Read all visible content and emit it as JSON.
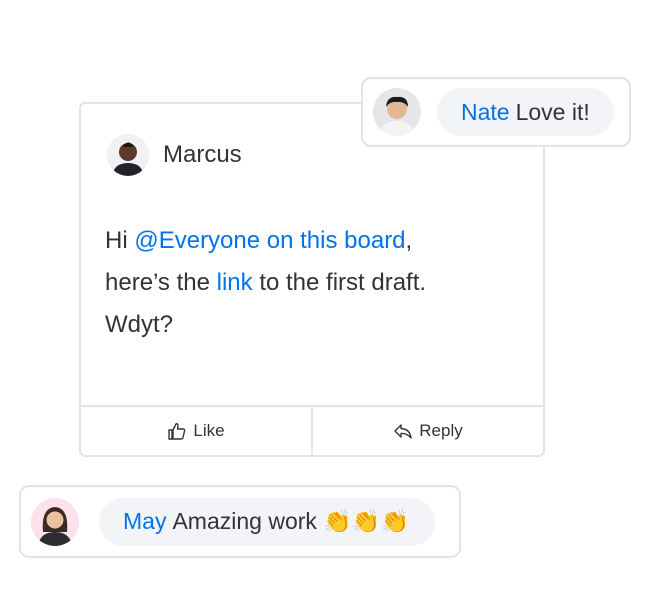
{
  "post": {
    "author": "Marcus",
    "message": {
      "part1": "Hi ",
      "mention": "@Everyone on this board",
      "part2": ",",
      "part3": "here’s the ",
      "link": "link",
      "part4": " to the first draft.",
      "part5": "Wdyt?"
    },
    "actions": {
      "like_label": "Like",
      "reply_label": "Reply"
    }
  },
  "replies": [
    {
      "author": "Nate",
      "text": "Love it!"
    },
    {
      "author": "May",
      "text": "Amazing work 👏👏👏"
    }
  ],
  "colors": {
    "accent": "#0073ea",
    "text": "#323338",
    "border": "#e2e4ec",
    "bubble": "#f2f4f8"
  }
}
